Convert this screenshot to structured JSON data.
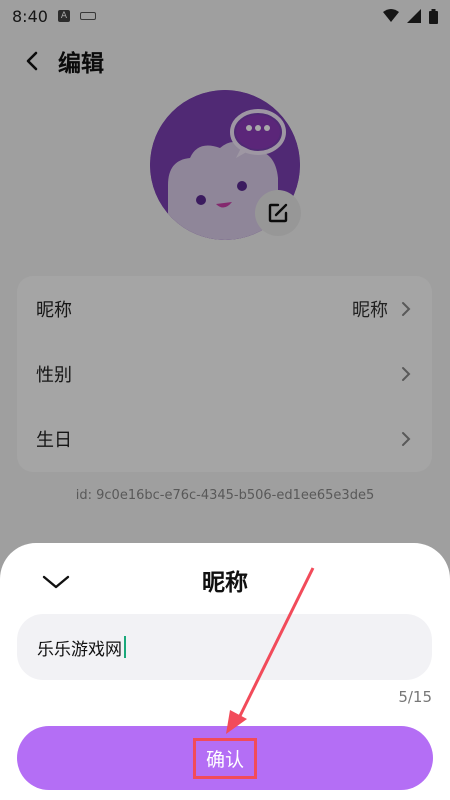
{
  "status_bar": {
    "time": "8:40",
    "a_badge": "A"
  },
  "header": {
    "title": "编辑"
  },
  "profile": {
    "rows": [
      {
        "label": "昵称",
        "value": "昵称"
      },
      {
        "label": "性别",
        "value": ""
      },
      {
        "label": "生日",
        "value": ""
      }
    ],
    "id_text": "id: 9c0e16bc-e76c-4345-b506-ed1ee65e3de5"
  },
  "sheet": {
    "title": "昵称",
    "input_value": "乐乐游戏网",
    "char_count": "5/15",
    "confirm_label": "确认"
  },
  "colors": {
    "accent": "#b46ef5",
    "avatar_bg": "#7a3fb0",
    "annotation": "#f24b5a"
  }
}
